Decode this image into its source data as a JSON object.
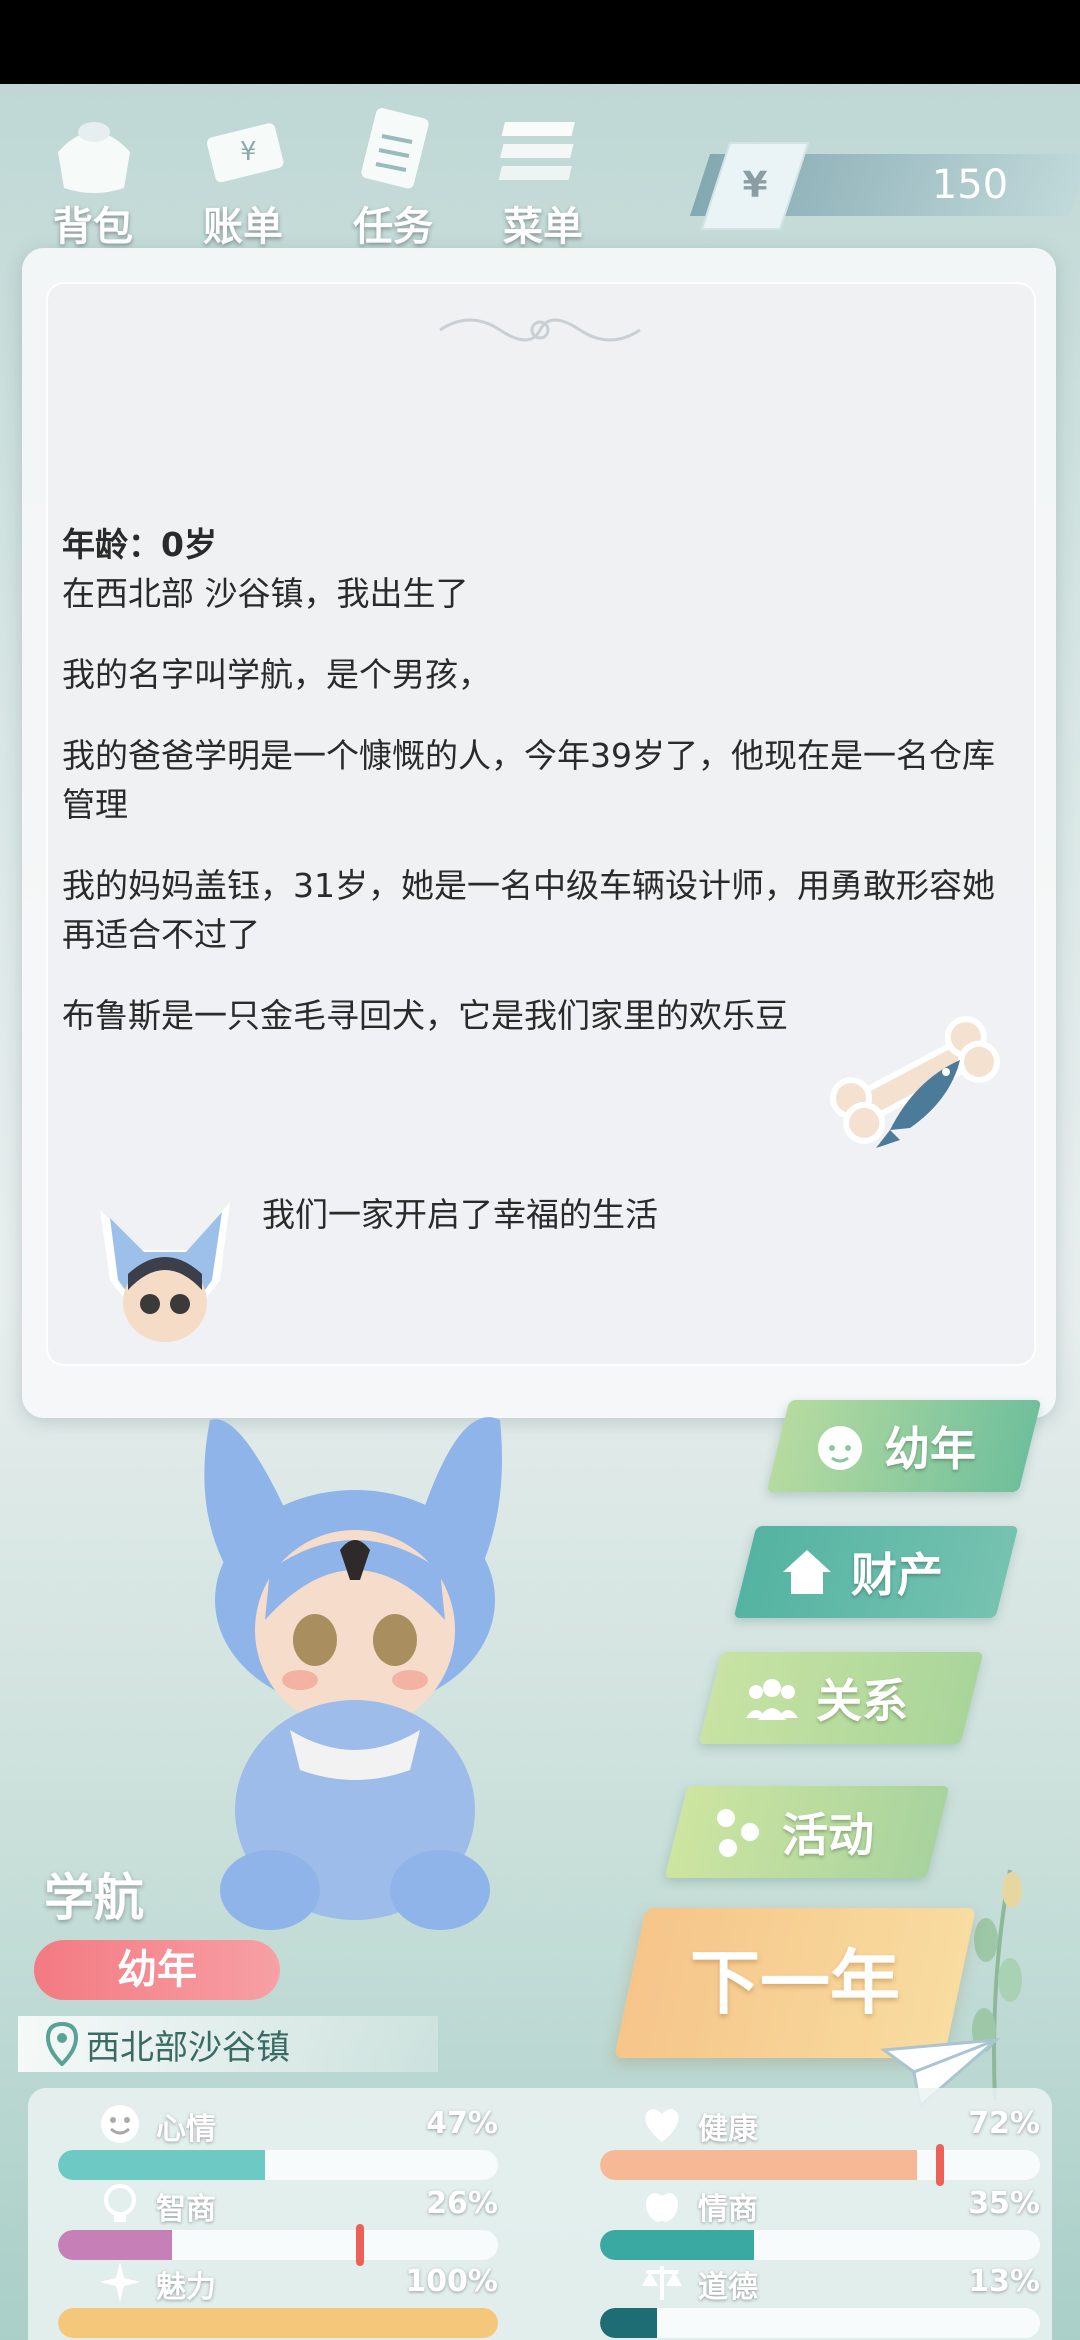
{
  "toolbar": {
    "items": [
      {
        "label": "背包",
        "icon": "bag-icon"
      },
      {
        "label": "账单",
        "icon": "bill-icon"
      },
      {
        "label": "任务",
        "icon": "task-icon"
      },
      {
        "label": "菜单",
        "icon": "menu-icon"
      }
    ],
    "money": {
      "symbol": "¥",
      "value": "150"
    }
  },
  "story": {
    "age_line": "年龄：0岁",
    "paragraphs": [
      "在西北部 沙谷镇，我出生了",
      "我的名字叫学航，是个男孩，",
      "我的爸爸学明是一个慷慨的人，今年39岁了，他现在是一名仓库管理",
      "我的妈妈盖钰，31岁，她是一名中级车辆设计师，用勇敢形容她再适合不过了",
      "布鲁斯是一只金毛寻回犬，它是我们家里的欢乐豆"
    ],
    "ending": "我们一家开启了幸福的生活"
  },
  "side_buttons": {
    "youth": "幼年",
    "assets": "财产",
    "relations": "关系",
    "activities": "活动",
    "next_year": "下一年"
  },
  "player": {
    "name": "学航",
    "stage": "幼年",
    "location": "西北部沙谷镇"
  },
  "stats": [
    {
      "name": "心情",
      "value": "47%",
      "fraction": 0.47,
      "color": "#6cc9c4",
      "icon": "smiley-icon"
    },
    {
      "name": "健康",
      "value": "72%",
      "fraction": 0.72,
      "color": "#f7b896",
      "icon": "heart-icon"
    },
    {
      "name": "智商",
      "value": "26%",
      "fraction": 0.26,
      "color": "#c77fb8",
      "icon": "lightbulb-icon"
    },
    {
      "name": "情商",
      "value": "35%",
      "fraction": 0.35,
      "color": "#3aa9a1",
      "icon": "apple-icon"
    },
    {
      "name": "魅力",
      "value": "100%",
      "fraction": 1.0,
      "color": "#f5c77a",
      "icon": "sparkle-icon"
    },
    {
      "name": "道德",
      "value": "13%",
      "fraction": 0.13,
      "color": "#1e6c74",
      "icon": "scale-icon"
    }
  ]
}
